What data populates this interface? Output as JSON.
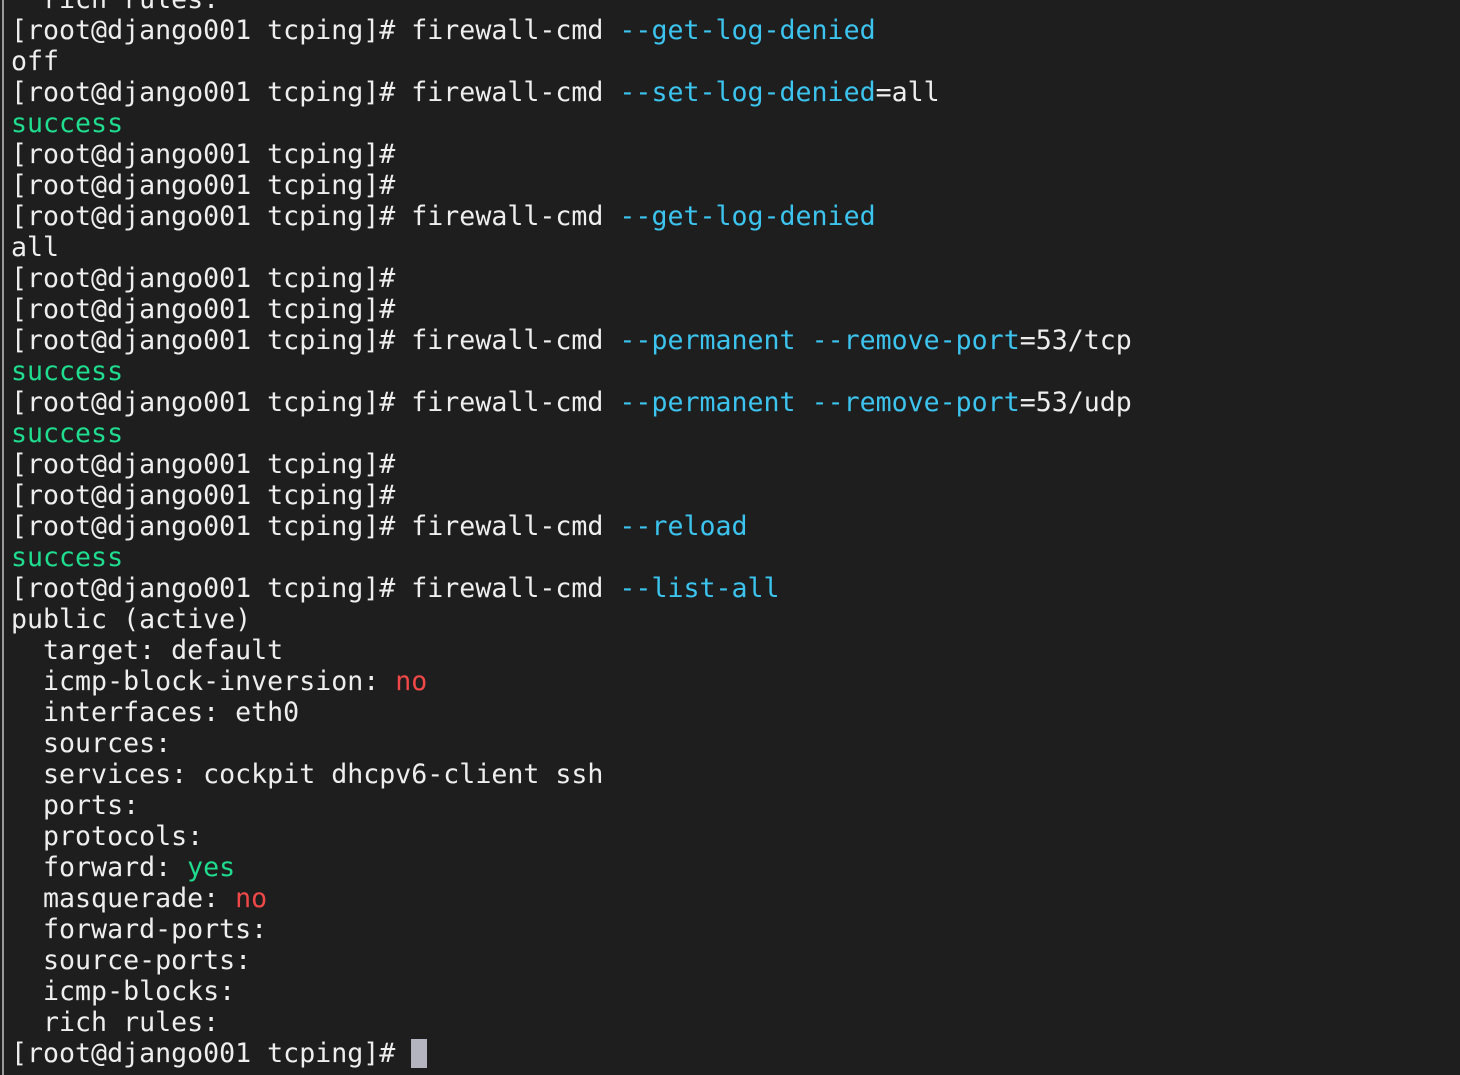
{
  "terminal": {
    "colors": {
      "default": "#eeeeee",
      "option": "#3cc3ee",
      "success": "#1fdc8e",
      "negative": "#f04848",
      "background": "#1e1e1e",
      "cursor": "#b4b4c0"
    },
    "lines": [
      [
        {
          "t": "  rich rules:",
          "c": "white"
        }
      ],
      [
        {
          "t": "[root@django001 tcping]# firewall-cmd ",
          "c": "white"
        },
        {
          "t": "--get-log-denied",
          "c": "cyan"
        }
      ],
      [
        {
          "t": "off",
          "c": "white"
        }
      ],
      [
        {
          "t": "[root@django001 tcping]# firewall-cmd ",
          "c": "white"
        },
        {
          "t": "--set-log-denied",
          "c": "cyan"
        },
        {
          "t": "=all",
          "c": "white"
        }
      ],
      [
        {
          "t": "success",
          "c": "green"
        }
      ],
      [
        {
          "t": "[root@django001 tcping]#",
          "c": "white"
        }
      ],
      [
        {
          "t": "[root@django001 tcping]#",
          "c": "white"
        }
      ],
      [
        {
          "t": "[root@django001 tcping]# firewall-cmd ",
          "c": "white"
        },
        {
          "t": "--get-log-denied",
          "c": "cyan"
        }
      ],
      [
        {
          "t": "all",
          "c": "white"
        }
      ],
      [
        {
          "t": "[root@django001 tcping]#",
          "c": "white"
        }
      ],
      [
        {
          "t": "[root@django001 tcping]#",
          "c": "white"
        }
      ],
      [
        {
          "t": "[root@django001 tcping]# firewall-cmd ",
          "c": "white"
        },
        {
          "t": "--permanent",
          "c": "cyan"
        },
        {
          "t": " ",
          "c": "white"
        },
        {
          "t": "--remove-port",
          "c": "cyan"
        },
        {
          "t": "=53/tcp",
          "c": "white"
        }
      ],
      [
        {
          "t": "success",
          "c": "green"
        }
      ],
      [
        {
          "t": "[root@django001 tcping]# firewall-cmd ",
          "c": "white"
        },
        {
          "t": "--permanent",
          "c": "cyan"
        },
        {
          "t": " ",
          "c": "white"
        },
        {
          "t": "--remove-port",
          "c": "cyan"
        },
        {
          "t": "=53/udp",
          "c": "white"
        }
      ],
      [
        {
          "t": "success",
          "c": "green"
        }
      ],
      [
        {
          "t": "[root@django001 tcping]#",
          "c": "white"
        }
      ],
      [
        {
          "t": "[root@django001 tcping]#",
          "c": "white"
        }
      ],
      [
        {
          "t": "[root@django001 tcping]# firewall-cmd ",
          "c": "white"
        },
        {
          "t": "--reload",
          "c": "cyan"
        }
      ],
      [
        {
          "t": "success",
          "c": "green"
        }
      ],
      [
        {
          "t": "[root@django001 tcping]# firewall-cmd ",
          "c": "white"
        },
        {
          "t": "--list-all",
          "c": "cyan"
        }
      ],
      [
        {
          "t": "public (active)",
          "c": "white"
        }
      ],
      [
        {
          "t": "  target: default",
          "c": "white"
        }
      ],
      [
        {
          "t": "  icmp-block-inversion: ",
          "c": "white"
        },
        {
          "t": "no",
          "c": "red"
        }
      ],
      [
        {
          "t": "  interfaces: eth0",
          "c": "white"
        }
      ],
      [
        {
          "t": "  sources:",
          "c": "white"
        }
      ],
      [
        {
          "t": "  services: cockpit dhcpv6-client ssh",
          "c": "white"
        }
      ],
      [
        {
          "t": "  ports:",
          "c": "white"
        }
      ],
      [
        {
          "t": "  protocols:",
          "c": "white"
        }
      ],
      [
        {
          "t": "  forward: ",
          "c": "white"
        },
        {
          "t": "yes",
          "c": "green"
        }
      ],
      [
        {
          "t": "  masquerade: ",
          "c": "white"
        },
        {
          "t": "no",
          "c": "red"
        }
      ],
      [
        {
          "t": "  forward-ports:",
          "c": "white"
        }
      ],
      [
        {
          "t": "  source-ports:",
          "c": "white"
        }
      ],
      [
        {
          "t": "  icmp-blocks:",
          "c": "white"
        }
      ],
      [
        {
          "t": "  rich rules:",
          "c": "white"
        }
      ],
      [
        {
          "t": "[root@django001 tcping]# ",
          "c": "white"
        }
      ]
    ]
  }
}
